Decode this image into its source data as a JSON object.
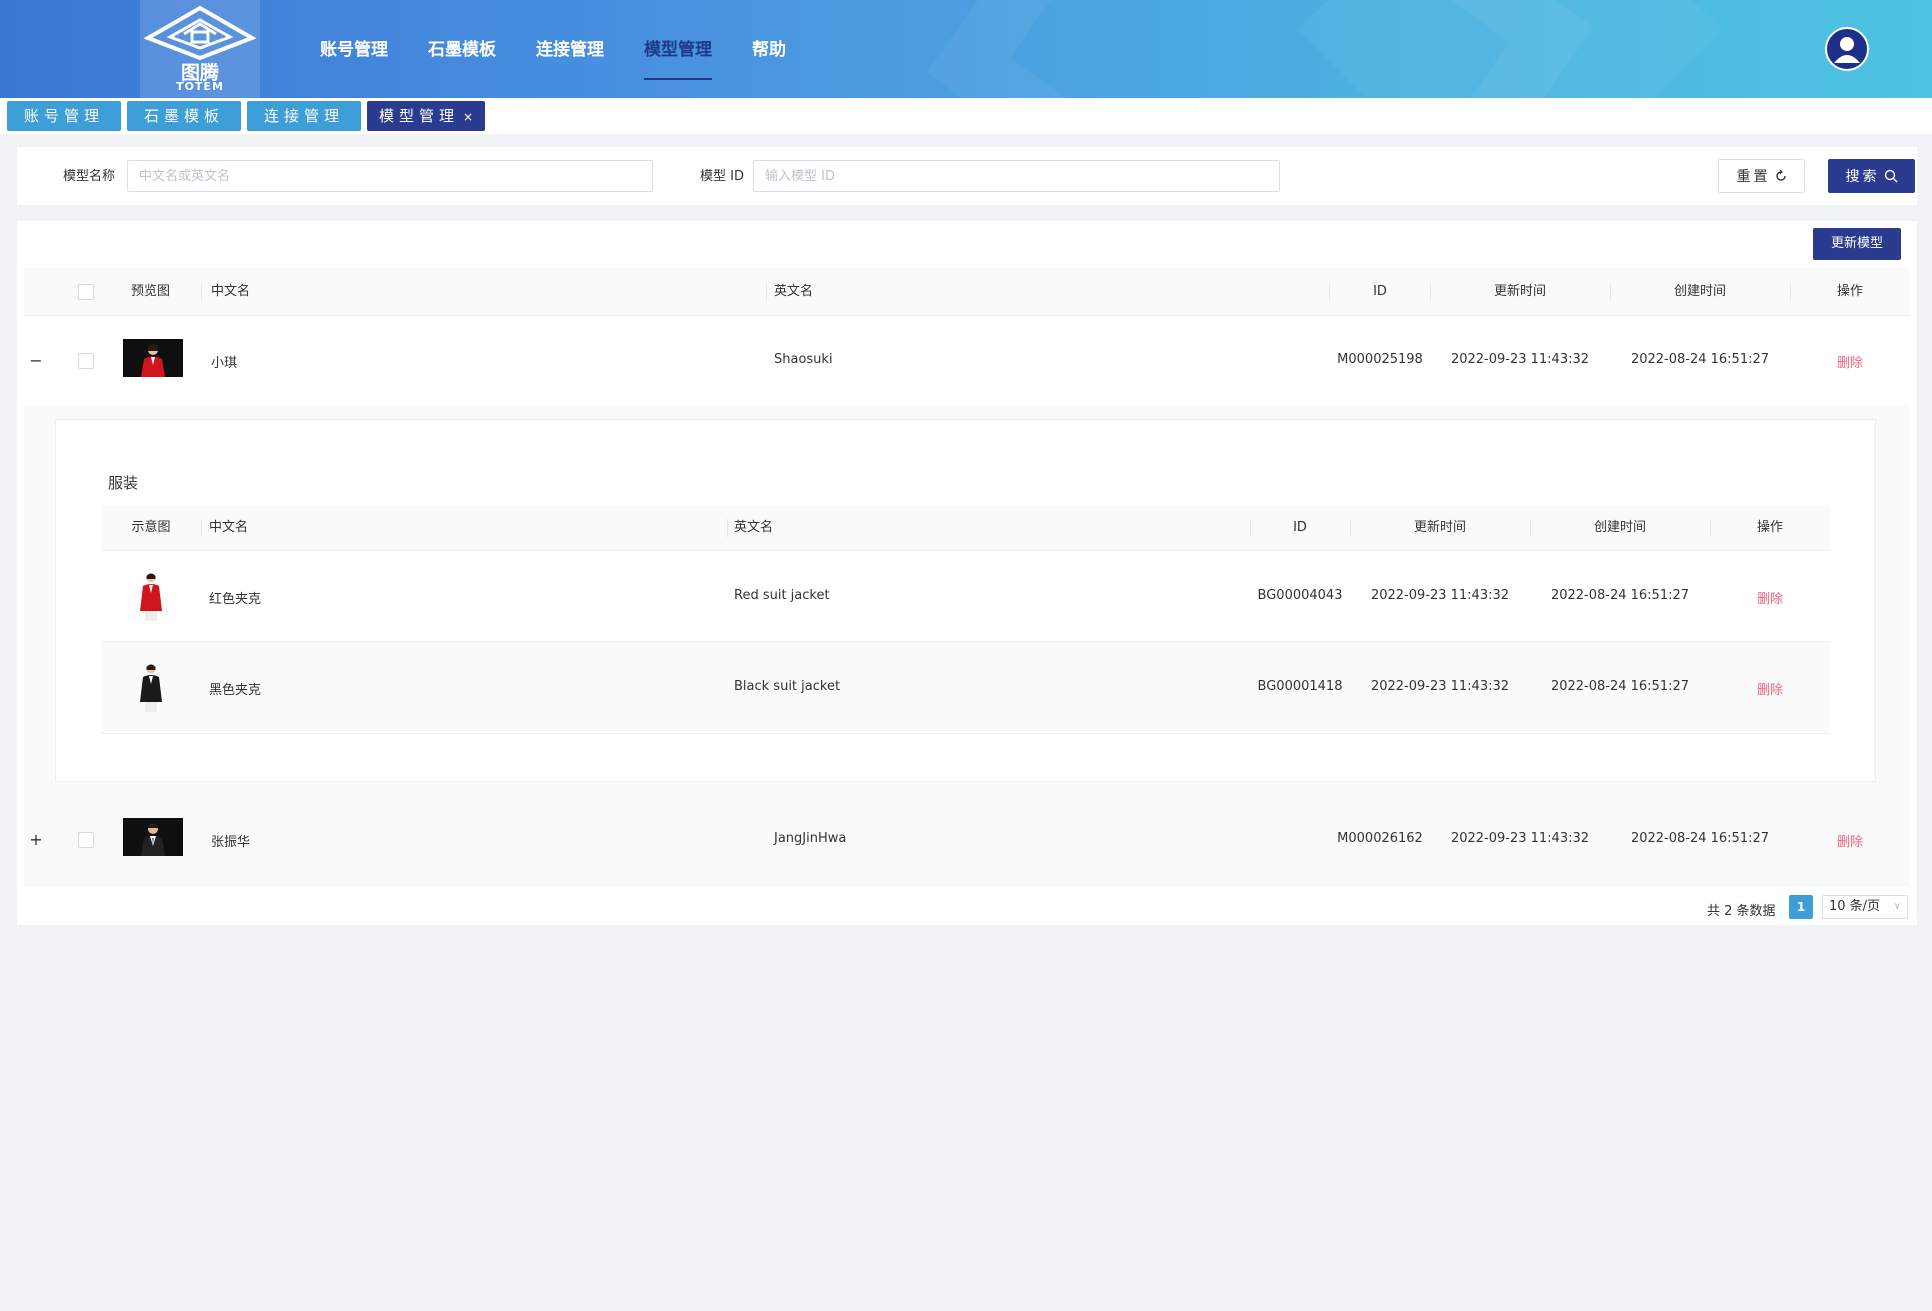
{
  "brand": {
    "name_cn": "图腾",
    "name_en": "TOTEM"
  },
  "nav": {
    "items": [
      {
        "label": "账号管理"
      },
      {
        "label": "石墨模板"
      },
      {
        "label": "连接管理"
      },
      {
        "label": "模型管理"
      },
      {
        "label": "帮助"
      }
    ],
    "active_index": 3
  },
  "tabs": [
    {
      "label": "账号管理"
    },
    {
      "label": "石墨模板"
    },
    {
      "label": "连接管理"
    },
    {
      "label": "模型管理",
      "close": "×"
    }
  ],
  "search": {
    "name_label": "模型名称",
    "name_placeholder": "中文名或英文名",
    "id_label": "模型 ID",
    "id_placeholder": "输入模型 ID",
    "reset_label": "重置",
    "search_label": "搜索"
  },
  "toolbar": {
    "update_label": "更新模型"
  },
  "table": {
    "headers": {
      "preview": "预览图",
      "cn_name": "中文名",
      "en_name": "英文名",
      "id": "ID",
      "updated": "更新时间",
      "created": "创建时间",
      "action": "操作"
    },
    "rows": [
      {
        "expand": "−",
        "cn_name": "小琪",
        "en_name": "Shaosuki",
        "id": "M000025198",
        "updated": "2022-09-23 11:43:32",
        "created": "2022-08-24 16:51:27",
        "action": "删除"
      },
      {
        "expand": "+",
        "cn_name": "张振华",
        "en_name": "JangJinHwa",
        "id": "M000026162",
        "updated": "2022-09-23 11:43:32",
        "created": "2022-08-24 16:51:27",
        "action": "删除"
      }
    ]
  },
  "clothing": {
    "title": "服装",
    "headers": {
      "image": "示意图",
      "cn_name": "中文名",
      "en_name": "英文名",
      "id": "ID",
      "updated": "更新时间",
      "created": "创建时间",
      "action": "操作"
    },
    "rows": [
      {
        "cn_name": "红色夹克",
        "en_name": "Red suit jacket",
        "id": "BG00004043",
        "updated": "2022-09-23 11:43:32",
        "created": "2022-08-24 16:51:27",
        "action": "删除",
        "jacket_color": "#d0151c"
      },
      {
        "cn_name": "黑色夹克",
        "en_name": "Black suit jacket",
        "id": "BG00001418",
        "updated": "2022-09-23 11:43:32",
        "created": "2022-08-24 16:51:27",
        "action": "删除",
        "jacket_color": "#1a1a1a"
      }
    ]
  },
  "pagination": {
    "total_text": "共 2 条数据",
    "current_page": "1",
    "page_size": "10 条/页"
  },
  "colors": {
    "primary": "#2b3b8f",
    "tab": "#3e9fd8",
    "danger": "#f5667a"
  }
}
